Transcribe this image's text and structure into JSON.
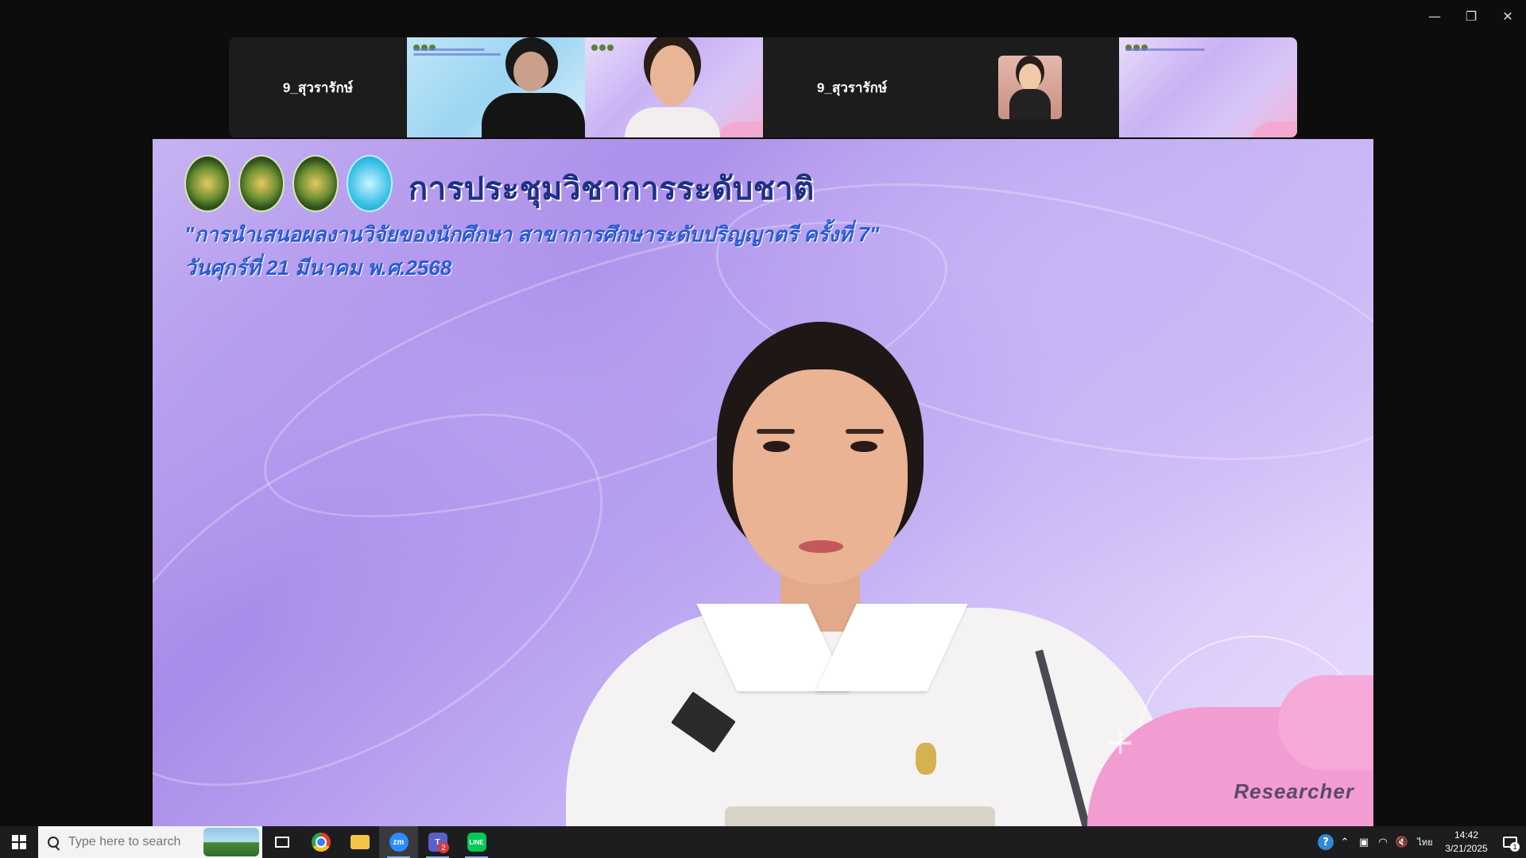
{
  "window": {
    "controls": {
      "minimize": "—",
      "restore": "❐",
      "close": "✕"
    }
  },
  "thumbnails": [
    {
      "type": "name",
      "label": "9_สุวรารักษ์"
    },
    {
      "type": "slide",
      "variant": "blue"
    },
    {
      "type": "slide",
      "variant": "purple"
    },
    {
      "type": "name",
      "label": "9_สุวรารักษ์"
    },
    {
      "type": "photo"
    },
    {
      "type": "slide",
      "variant": "purple"
    }
  ],
  "main": {
    "title": "การประชุมวิชาการระดับชาติ",
    "subtitle": "\"การนำเสนอผลงานวิจัยของนักศึกษา สาขาการศึกษาระดับปริญญาตรี ครั้งที่ 7\"",
    "date": "วันศุกร์ที่  21 มีนาคม พ.ศ.2568",
    "badge": "Researcher"
  },
  "taskbar": {
    "search_placeholder": "Type here to search",
    "apps": [
      {
        "name": "chrome",
        "active": false
      },
      {
        "name": "file-explorer",
        "active": false
      },
      {
        "name": "zoom",
        "label": "zm",
        "active": true
      },
      {
        "name": "teams",
        "label": "T",
        "badge": "2",
        "active": false
      },
      {
        "name": "line",
        "label": "LINE",
        "active": false
      }
    ],
    "tray": {
      "language": "ไทย",
      "time": "14:42",
      "date": "3/21/2025",
      "notifications": "1"
    }
  },
  "colors": {
    "title": "#1e2f86",
    "subtitle": "#2a5bd0",
    "slide_bg": "#c6b3f3",
    "accent_pink": "#f39cd2"
  }
}
